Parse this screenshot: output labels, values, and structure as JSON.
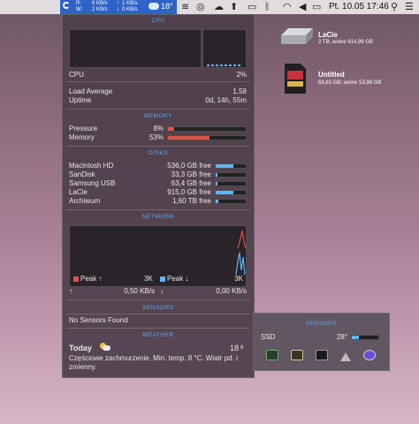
{
  "menubar": {
    "network_labels": [
      "R:",
      "W:"
    ],
    "net_down_in": "0 KB/s",
    "net_down_out": "2 KB/s",
    "net_up_in": "1 KB/s",
    "net_up_out": "0 KB/s",
    "weather_temp": "18°",
    "clock": "Pt. 10.05  17:46"
  },
  "desktop": {
    "drives": [
      {
        "name": "LaCie",
        "info": "2 TB; wolne 914,99 GB"
      },
      {
        "name": "Untitled",
        "info": "63,83 GB; wolne 53,98 GB"
      }
    ]
  },
  "cpu": {
    "title": "CPU",
    "label": "CPU",
    "value": "2%",
    "load_label": "Load Average",
    "load_value": "1,58",
    "uptime_label": "Uptime",
    "uptime_value": "0d, 14h, 55m"
  },
  "memory": {
    "title": "MEMORY",
    "pressure_label": "Pressure",
    "pressure_value": "8%",
    "pressure_fraction": 0.08,
    "memory_label": "Memory",
    "memory_value": "53%",
    "memory_fraction": 0.53,
    "bar_color": "#e0534a"
  },
  "disks": {
    "title": "DISKS",
    "bar_color": "#5db6f2",
    "items": [
      {
        "name": "Macintosh HD",
        "free": "536,0 GB free",
        "used_fraction": 0.6
      },
      {
        "name": "SanDisk",
        "free": "33,3 GB free",
        "used_fraction": 0.05
      },
      {
        "name": "Samsung USB",
        "free": "63,4 GB free",
        "used_fraction": 0.05
      },
      {
        "name": "LaCie",
        "free": "915,0 GB free",
        "used_fraction": 0.6
      },
      {
        "name": "Archiwum",
        "free": "1,60 TB free",
        "used_fraction": 0.1
      }
    ]
  },
  "network": {
    "title": "NETWORK",
    "peak_up_label": "Peak ↑",
    "peak_up_value": "3K",
    "peak_down_label": "Peak ↓",
    "peak_down_value": "3K",
    "up_arrow": "↑",
    "rate_up": "0,50 KB/s",
    "down_arrow": "↓",
    "rate_down": "0,00 KB/s",
    "up_color": "#e0534a",
    "down_color": "#5db6f2"
  },
  "sensors": {
    "title": "SENSORS",
    "empty_text": "No Sensors Found"
  },
  "weather": {
    "title": "WEATHER",
    "day": "Today",
    "temp": "18",
    "temp_unit": "8",
    "description": "Częściowe zachmurzenie. Min. temp. 8 °C. Wiatr pd. i zmienny."
  },
  "sensors_popover": {
    "title": "SENSORS",
    "sensor_name": "SSD",
    "sensor_value": "28°",
    "sensor_fraction": 0.28,
    "bar_color": "#5db6f2"
  }
}
